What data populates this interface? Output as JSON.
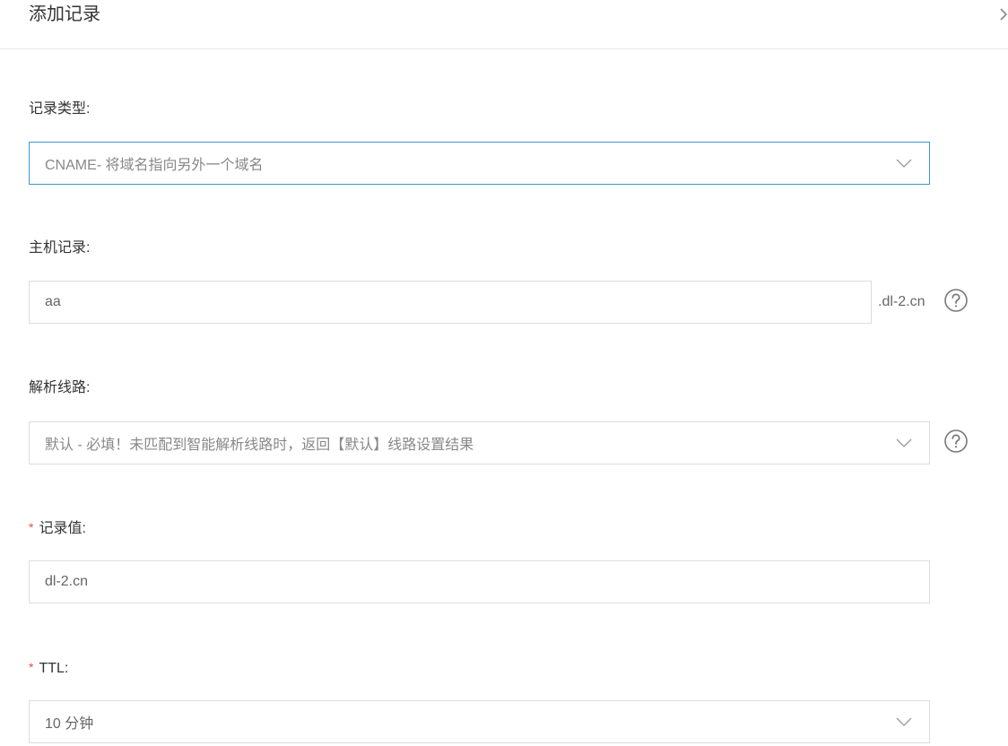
{
  "dialog": {
    "title": "添加记录",
    "close_icon": "close-icon"
  },
  "form": {
    "record_type": {
      "label": "记录类型:",
      "value": "CNAME- 将域名指向另外一个域名"
    },
    "host_record": {
      "label": "主机记录:",
      "value": "aa",
      "suffix": ".dl-2.cn",
      "help_icon": "question-circle-icon"
    },
    "resolution_line": {
      "label": "解析线路:",
      "value": "默认 - 必填！未匹配到智能解析线路时，返回【默认】线路设置结果",
      "help_icon": "question-circle-icon"
    },
    "record_value": {
      "required_mark": "*",
      "label": "记录值:",
      "value": "dl-2.cn"
    },
    "ttl": {
      "required_mark": "*",
      "label": "TTL:",
      "value": "10 分钟"
    }
  },
  "colors": {
    "focus_border": "#3e95d3",
    "required": "#e64a4a",
    "border": "#dcdcdc"
  }
}
